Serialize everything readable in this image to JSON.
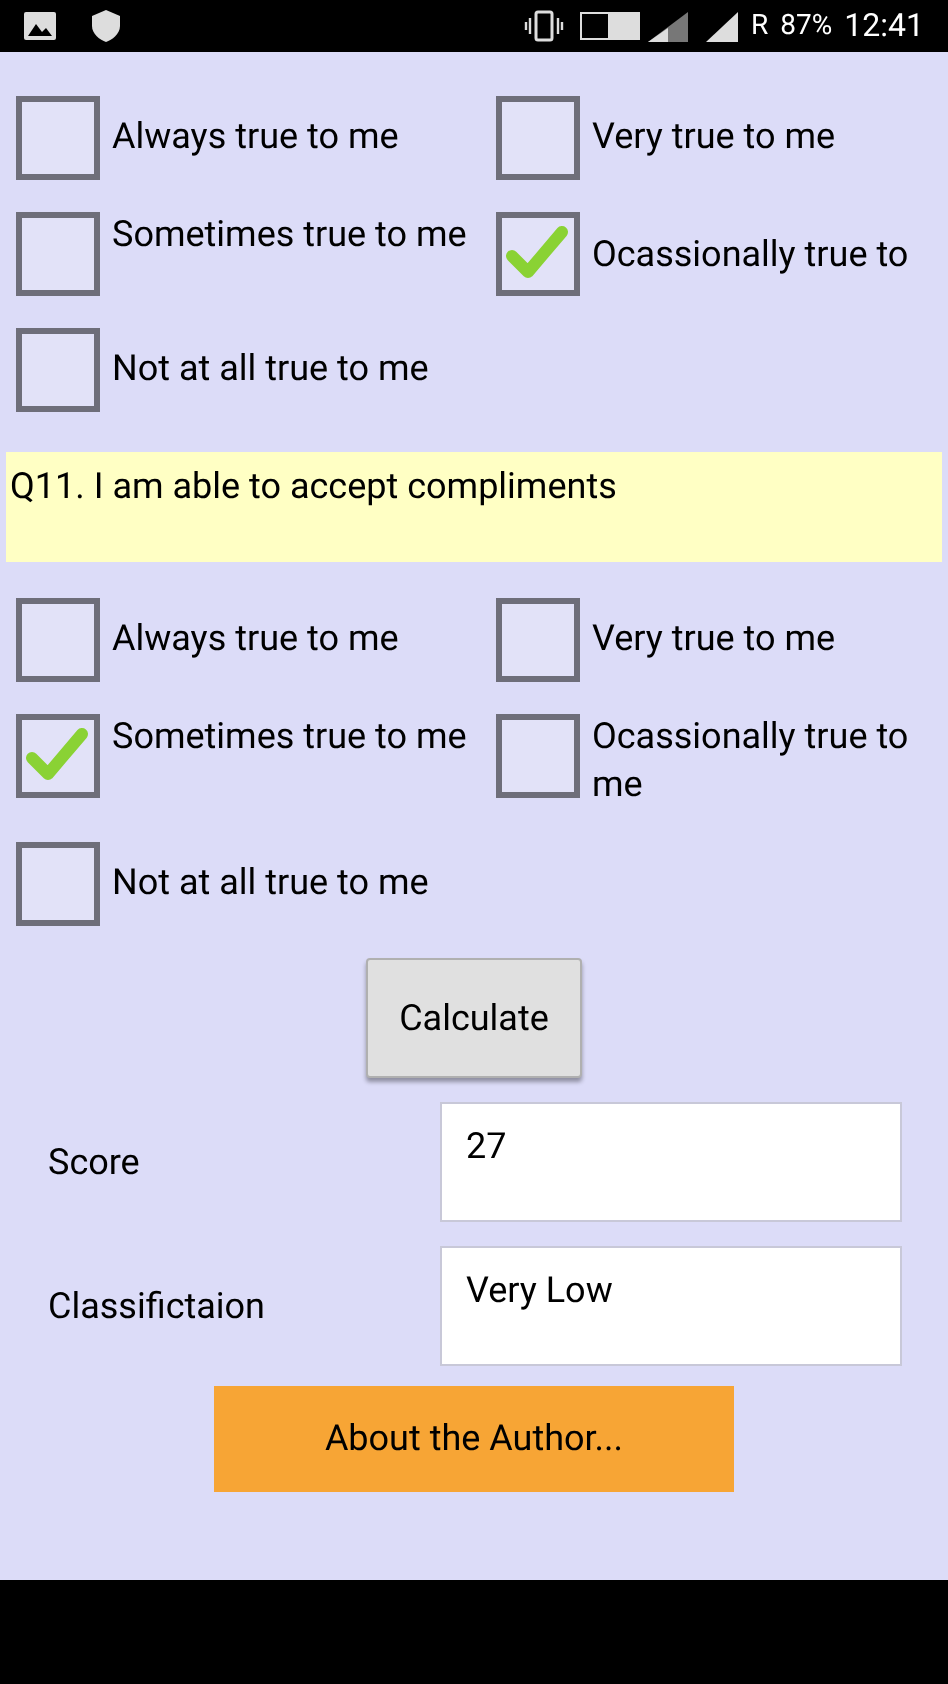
{
  "status_bar": {
    "carrier_mark": "R",
    "battery": "87%",
    "time": "12:41"
  },
  "questions": [
    {
      "options": [
        {
          "label": "Always true to me",
          "checked": false
        },
        {
          "label": "Very true to me",
          "checked": false
        },
        {
          "label": "Sometimes true to me",
          "checked": false
        },
        {
          "label": "Ocassionally true to",
          "checked": true
        },
        {
          "label": "Not at all true to me",
          "checked": false
        }
      ]
    },
    {
      "question": "Q11. I am able to accept compliments",
      "options": [
        {
          "label": "Always true to me",
          "checked": false
        },
        {
          "label": "Very true to me",
          "checked": false
        },
        {
          "label": "Sometimes true to me",
          "checked": true
        },
        {
          "label": "Ocassionally true to me",
          "checked": false
        },
        {
          "label": "Not at all true to me",
          "checked": false
        }
      ]
    }
  ],
  "calculate_button": "Calculate",
  "results": [
    {
      "label": "Score",
      "value": "27"
    },
    {
      "label": "Classifictaion",
      "value": "Very Low"
    }
  ],
  "about_button": "About the Author..."
}
